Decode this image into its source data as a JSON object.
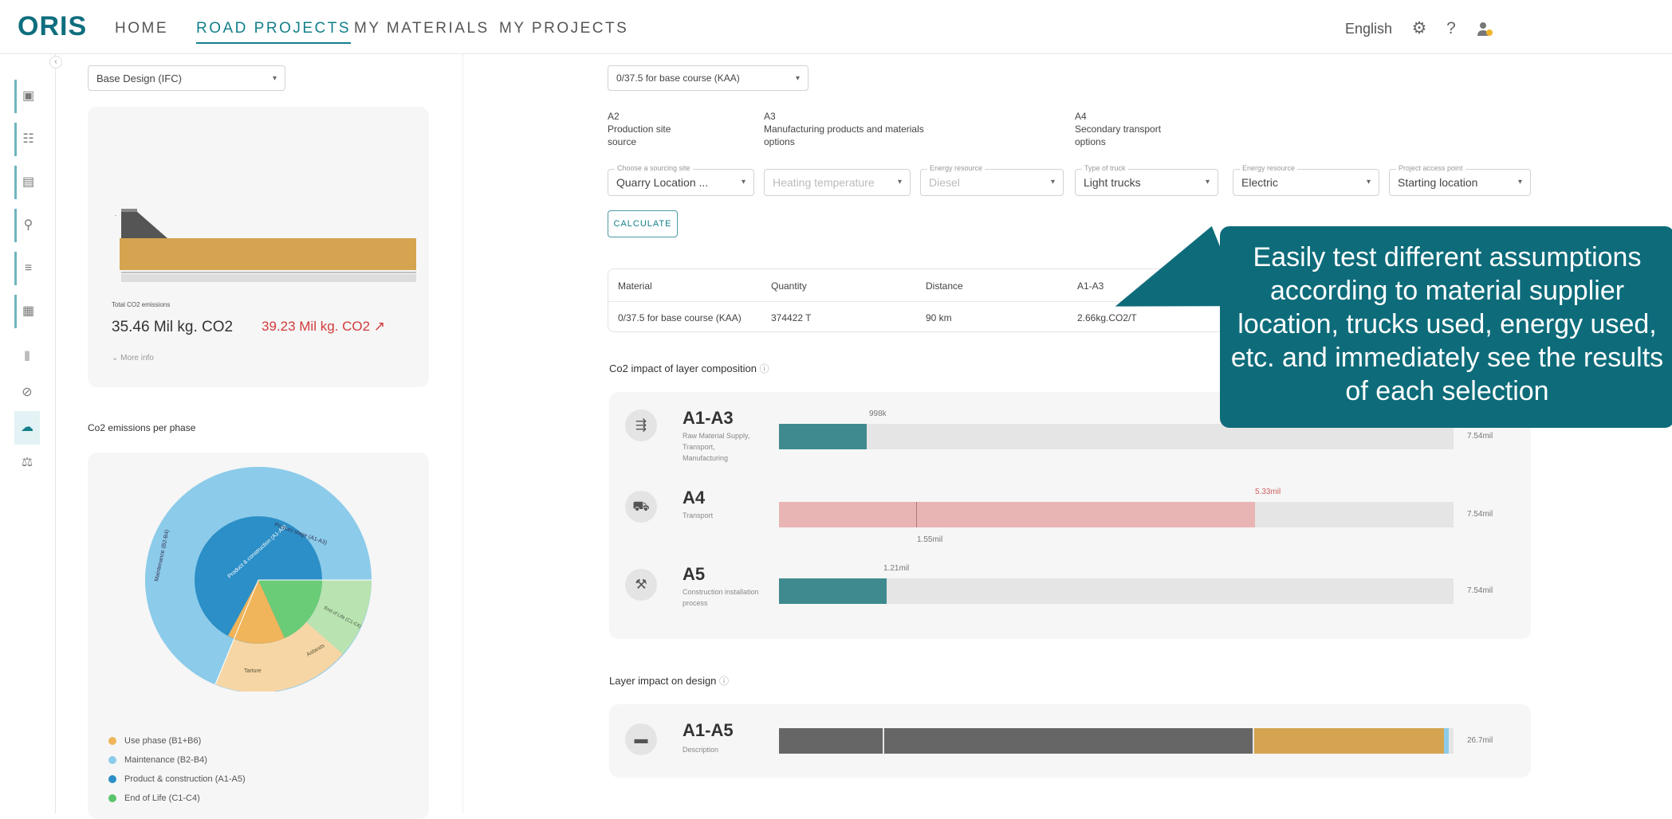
{
  "app": {
    "logo": "ORIS",
    "language": "English"
  },
  "nav": {
    "home": "HOME",
    "road_projects": "ROAD PROJECTS",
    "my_materials": "MY MATERIALS",
    "my_projects": "MY PROJECTS"
  },
  "left": {
    "design_select": "Base Design (IFC)",
    "total_label": "Total CO2 emissions",
    "total_value": "35.46 Mil kg. CO2",
    "compare_value": "39.23 Mil kg. CO2 ↗",
    "more_info": "More info",
    "phase_title": "Co2 emissions per phase",
    "pie_labels": {
      "product_stage": "Product stage (A1-A3)",
      "product_construction": "Product & construction (A1-A5)",
      "maintenance": "Maintenance (B2-B4)",
      "tarture": "Tarture",
      "asbests": "Asbests",
      "end_of_life": "End of Life (C1-C4)"
    },
    "legend": [
      {
        "label": "Use phase (B1+B6)",
        "color": "#f0b45a"
      },
      {
        "label": "Maintenance (B2-B4)",
        "color": "#8ccbea"
      },
      {
        "label": "Product & construction (A1-A5)",
        "color": "#2c8fc7"
      },
      {
        "label": "End of Life (C1-C4)",
        "color": "#5bc46a"
      }
    ]
  },
  "main": {
    "material_select": "0/37.5 for base course (KAA)",
    "sections": {
      "a2": {
        "code": "A2",
        "line1": "Production site",
        "line2": "source"
      },
      "a3": {
        "code": "A3",
        "line1": "Manufacturing products and materials",
        "line2": "options"
      },
      "a4": {
        "code": "A4",
        "line1": "Secondary transport",
        "line2": "options"
      }
    },
    "fields": [
      {
        "label": "Choose a sourcing site",
        "value": "Quarry Location ...",
        "disabled": false
      },
      {
        "label": "",
        "value": "Heating temperature",
        "disabled": true
      },
      {
        "label": "Energy resource",
        "value": "Diesel",
        "disabled": true
      },
      {
        "label": "Type of truck",
        "value": "Light trucks",
        "disabled": false
      },
      {
        "label": "Energy resource",
        "value": "Electric",
        "disabled": false
      },
      {
        "label": "Project access point",
        "value": "Starting location",
        "disabled": false
      }
    ],
    "calculate": "CALCULATE",
    "table": {
      "headers": {
        "material": "Material",
        "quantity": "Quantity",
        "distance": "Distance",
        "a1a3": "A1-A3"
      },
      "row": {
        "material": "0/37.5 for base course (KAA)",
        "quantity": "374422 T",
        "distance": "90 km",
        "a1a3": "2.66kg.CO2/T"
      }
    },
    "layer_title": "Co2 impact of layer composition",
    "rows": [
      {
        "code": "A1-A3",
        "sub": "Raw Material Supply, Transport, Manufacturing",
        "mark": "998k",
        "end": "7.54mil",
        "fill": 0.13,
        "color": "#3e8a8e"
      },
      {
        "code": "A4",
        "sub": "Transport",
        "mark": "5.33mil",
        "sub_mark": "1.55mil",
        "end": "7.54mil",
        "fill": 0.706,
        "color": "#e9b4b4"
      },
      {
        "code": "A5",
        "sub": "Construction installation process",
        "mark": "1.21mil",
        "end": "7.54mil",
        "fill": 0.16,
        "color": "#3e8a8e"
      }
    ],
    "design_title": "Layer impact on design",
    "design_row": {
      "code": "A1-A5",
      "sub": "Description",
      "end": "26.7mil"
    }
  },
  "callout": {
    "text": "Easily test different assumptions according to material supplier location, trucks used, energy used, etc. and immediately see the results of each selection"
  }
}
